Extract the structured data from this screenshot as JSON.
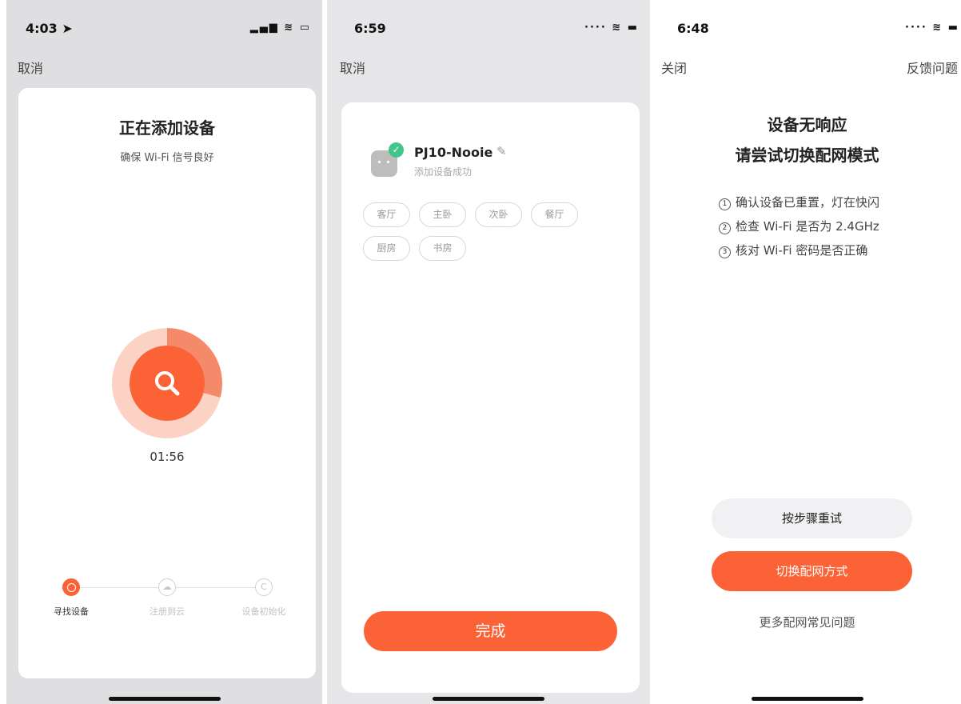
{
  "screens": [
    {
      "status": {
        "time": "4:03 ➤",
        "icons": "▂▄▆ ≋ ▭"
      },
      "nav": {
        "cancel": "取消"
      },
      "title": "正在添加设备",
      "subtitle": "确保 Wi-Fi 信号良好",
      "radar_icon": "search-icon",
      "timer": "01:56",
      "steps": [
        {
          "label": "寻找设备",
          "icon": "searching-dot",
          "active": true
        },
        {
          "label": "注册到云",
          "icon": "cloud-icon",
          "glyph": "☁",
          "active": false
        },
        {
          "label": "设备初始化",
          "icon": "init-icon",
          "glyph": "C",
          "active": false
        }
      ]
    },
    {
      "status": {
        "time": "6:59",
        "icons": "···· ≋ ▬"
      },
      "nav": {
        "cancel": "取消"
      },
      "device": {
        "name": "PJ10-Nooie",
        "status": "添加设备成功",
        "icon": "smart-plug-icon",
        "check": "✓",
        "edit": "✎"
      },
      "rooms": [
        "客厅",
        "主卧",
        "次卧",
        "餐厅",
        "厨房",
        "书房"
      ],
      "done_label": "完成"
    },
    {
      "status": {
        "time": "6:48",
        "icons": "···· ≋ ▬"
      },
      "nav": {
        "close": "关闭",
        "feedback": "反馈问题"
      },
      "title_line1": "设备无响应",
      "title_line2": "请尝试切换配网模式",
      "tips": [
        {
          "num": "1",
          "text": "确认设备已重置，灯在快闪"
        },
        {
          "num": "2",
          "text": "检查 Wi-Fi 是否为 2.4GHz"
        },
        {
          "num": "3",
          "text": "核对 Wi-Fi 密码是否正确"
        }
      ],
      "retry_label": "按步骤重试",
      "switch_label": "切换配网方式",
      "faq_label": "更多配网常见问题"
    }
  ],
  "colors": {
    "accent": "#fb6236",
    "success": "#41c58b",
    "muted": "#999999"
  }
}
